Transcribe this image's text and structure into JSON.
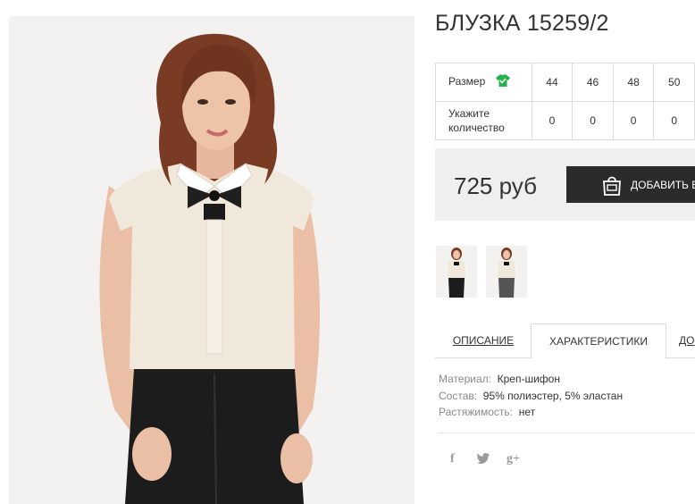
{
  "product": {
    "title": "БЛУЗКА 15259/2"
  },
  "size_table": {
    "size_label": "Размер",
    "size_icon": "shirt-icon",
    "quantity_label": "Укажите количество",
    "sizes": [
      "44",
      "46",
      "48",
      "50"
    ],
    "quantities": [
      "0",
      "0",
      "0",
      "0"
    ]
  },
  "purchase": {
    "price": "725 руб",
    "add_button_label": "ДОБАВИТЬ В",
    "add_button_icon": "shopping-bag-icon"
  },
  "gallery": {
    "thumbnails": [
      "thumbnail-front",
      "thumbnail-back"
    ]
  },
  "tabs": [
    {
      "label": "ОПИСАНИЕ",
      "active": false
    },
    {
      "label": "ХАРАКТЕРИСТИКИ",
      "active": true
    },
    {
      "label": "ДО",
      "active": false
    }
  ],
  "characteristics": [
    {
      "key": "Материал:",
      "value": "Креп-шифон"
    },
    {
      "key": "Состав:",
      "value": "95% полиэстер, 5% эластан"
    },
    {
      "key": "Растяжимость:",
      "value": "нет"
    }
  ],
  "social": {
    "facebook": "f",
    "twitter_icon": "twitter-icon",
    "googleplus": "g+"
  },
  "colors": {
    "button_bg": "#2b2b2b",
    "price_bar_bg": "#efefef",
    "size_icon": "#22b14c"
  }
}
